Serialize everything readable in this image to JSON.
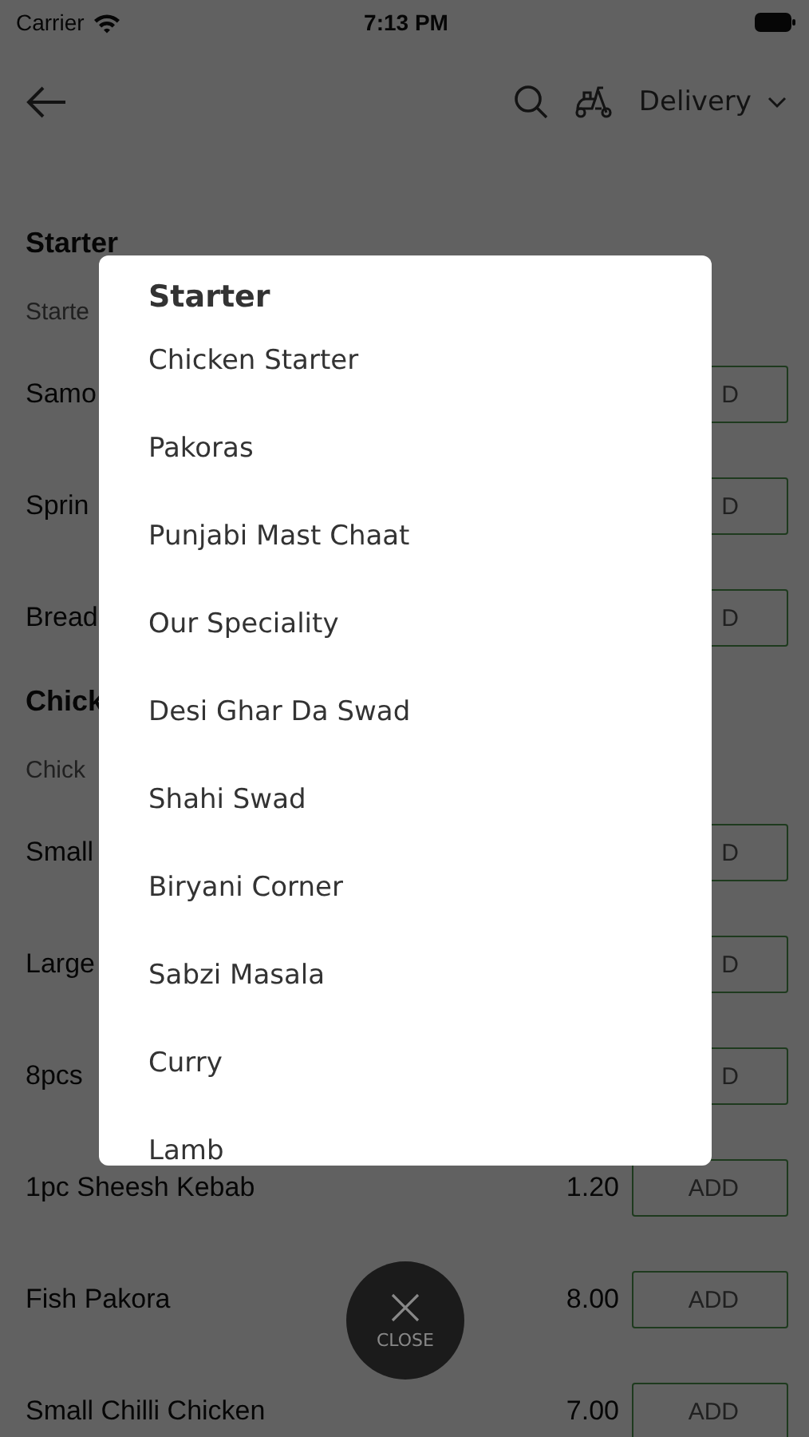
{
  "status_bar": {
    "carrier": "Carrier",
    "time": "7:13 PM"
  },
  "header": {
    "delivery_mode": "Delivery"
  },
  "sections": [
    {
      "title": "Starter",
      "subtitle": "Starte",
      "items": [
        {
          "name": "Samo",
          "add_label": "D"
        },
        {
          "name": "Sprin",
          "add_label": "D"
        },
        {
          "name": "Bread",
          "add_label": "D"
        }
      ]
    },
    {
      "title": "Chick",
      "subtitle": "Chick",
      "items": [
        {
          "name": "Small",
          "add_label": "D"
        },
        {
          "name": "Large",
          "add_label": "D"
        },
        {
          "name": "8pcs",
          "add_label": "D"
        },
        {
          "name": "1pc Sheesh Kebab",
          "price": "1.20",
          "add_label": "ADD"
        },
        {
          "name": "Fish Pakora",
          "price": "8.00",
          "add_label": "ADD"
        },
        {
          "name": "Small Chilli Chicken",
          "price": "7.00",
          "add_label": "ADD"
        }
      ]
    }
  ],
  "category_menu": {
    "title": "Starter",
    "items": [
      "Chicken Starter",
      "Pakoras",
      "Punjabi Mast Chaat",
      "Our Speciality",
      "Desi Ghar Da Swad",
      "Shahi Swad",
      "Biryani Corner",
      "Sabzi Masala",
      "Curry",
      "Lamb"
    ]
  },
  "close_button": {
    "label": "CLOSE"
  }
}
